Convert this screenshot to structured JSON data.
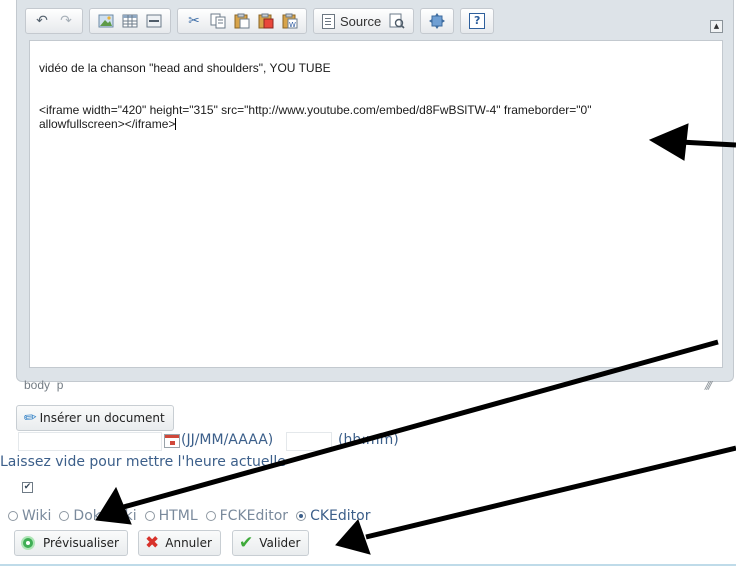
{
  "editor": {
    "toolbar": {
      "source_label": "Source",
      "icons": [
        "undo-icon",
        "redo-icon",
        "image-icon",
        "table-icon",
        "horizontal-rule-icon",
        "cut-icon",
        "copy-icon",
        "paste-icon",
        "paste-text-icon",
        "paste-word-icon",
        "source-icon",
        "preview-icon",
        "maximize-icon",
        "help-icon"
      ],
      "help_label": "?"
    },
    "content_line1": "vidéo de la chanson \"head and shoulders\", YOU TUBE",
    "content_line2": "<iframe width=\"420\" height=\"315\" src=\"http://www.youtube.com/embed/d8FwBSlTW-4\" frameborder=\"0\"",
    "content_line3": "allowfullscreen></iframe>",
    "path_body": "body",
    "path_p": "p"
  },
  "form": {
    "insert_document": "Insérer un document",
    "date_format": "(JJ/MM/AAAA)",
    "time_format": "(hh:mm)",
    "hint": "Laissez vide pour mettre l'heure actuelle",
    "checkbox_checked": true,
    "syntax_options": [
      "Wiki",
      "Dokuwiki",
      "HTML",
      "FCKEditor",
      "CKEditor"
    ],
    "syntax_selected": "CKEditor",
    "preview_label": "Prévisualiser",
    "cancel_label": "Annuler",
    "validate_label": "Valider"
  },
  "colors": {
    "link_blue": "#3c5f8a",
    "frame_bg": "#dde3e8",
    "preview_green": "#3fae55",
    "cancel_red": "#d8322b",
    "validate_green": "#3eaa3a",
    "annotation_arrow": "#000000"
  }
}
